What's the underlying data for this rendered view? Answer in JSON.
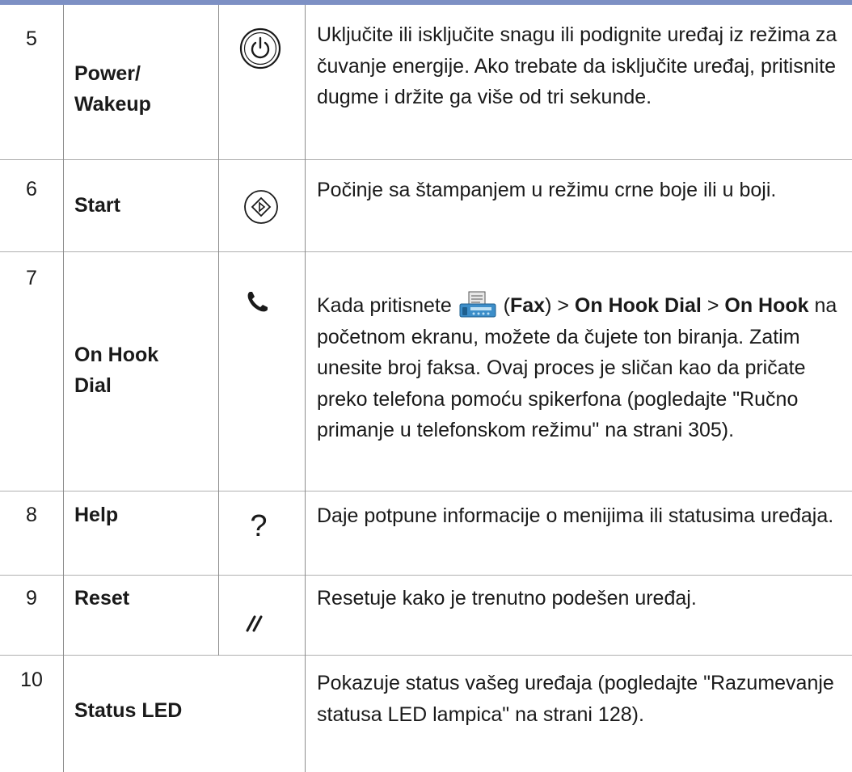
{
  "rows": [
    {
      "num": "5",
      "name_line1": "Power/",
      "name_line2": "Wakeup",
      "icon": "power-icon",
      "desc": "Uključite ili isključite snagu ili podignite uređaj iz režima za čuvanje energije. Ako trebate da isključite uređaj, pritisnite dugme i držite ga više od tri sekunde."
    },
    {
      "num": "6",
      "name": "Start",
      "icon": "start-icon",
      "desc": "Počinje sa štampanjem u režimu crne boje ili u boji."
    },
    {
      "num": "7",
      "name_line1": "On Hook",
      "name_line2": "Dial",
      "icon": "phone-handset-icon",
      "desc_parts": {
        "t1": "Kada pritisnete ",
        "t2": " (",
        "b1": "Fax",
        "t3": ") > ",
        "b2": "On Hook Dial",
        "t4": " > ",
        "b3": "On Hook",
        "t5": " na početnom ekranu, možete da čujete ton biranja. Zatim unesite broj faksa. Ovaj proces je sličan kao da pričate preko telefona pomoću spikerfona (pogledajte \"Ručno primanje u telefonskom režimu\" na strani 305)."
      }
    },
    {
      "num": "8",
      "name": "Help",
      "icon": "question-mark-icon",
      "icon_glyph": "?",
      "desc": "Daje potpune informacije o menijima ili statusima uređaja."
    },
    {
      "num": "9",
      "name": "Reset",
      "icon": "reset-icon",
      "icon_glyph": "//",
      "desc": "Resetuje kako je trenutno podešen uređaj."
    },
    {
      "num": "10",
      "name": "Status LED",
      "desc": "Pokazuje status vašeg uređaja (pogledajte \"Razumevanje statusa LED lampica\" na strani 128)."
    }
  ],
  "colors": {
    "accent_bar": "#7d90c4",
    "grid": "#b0b0b0"
  }
}
